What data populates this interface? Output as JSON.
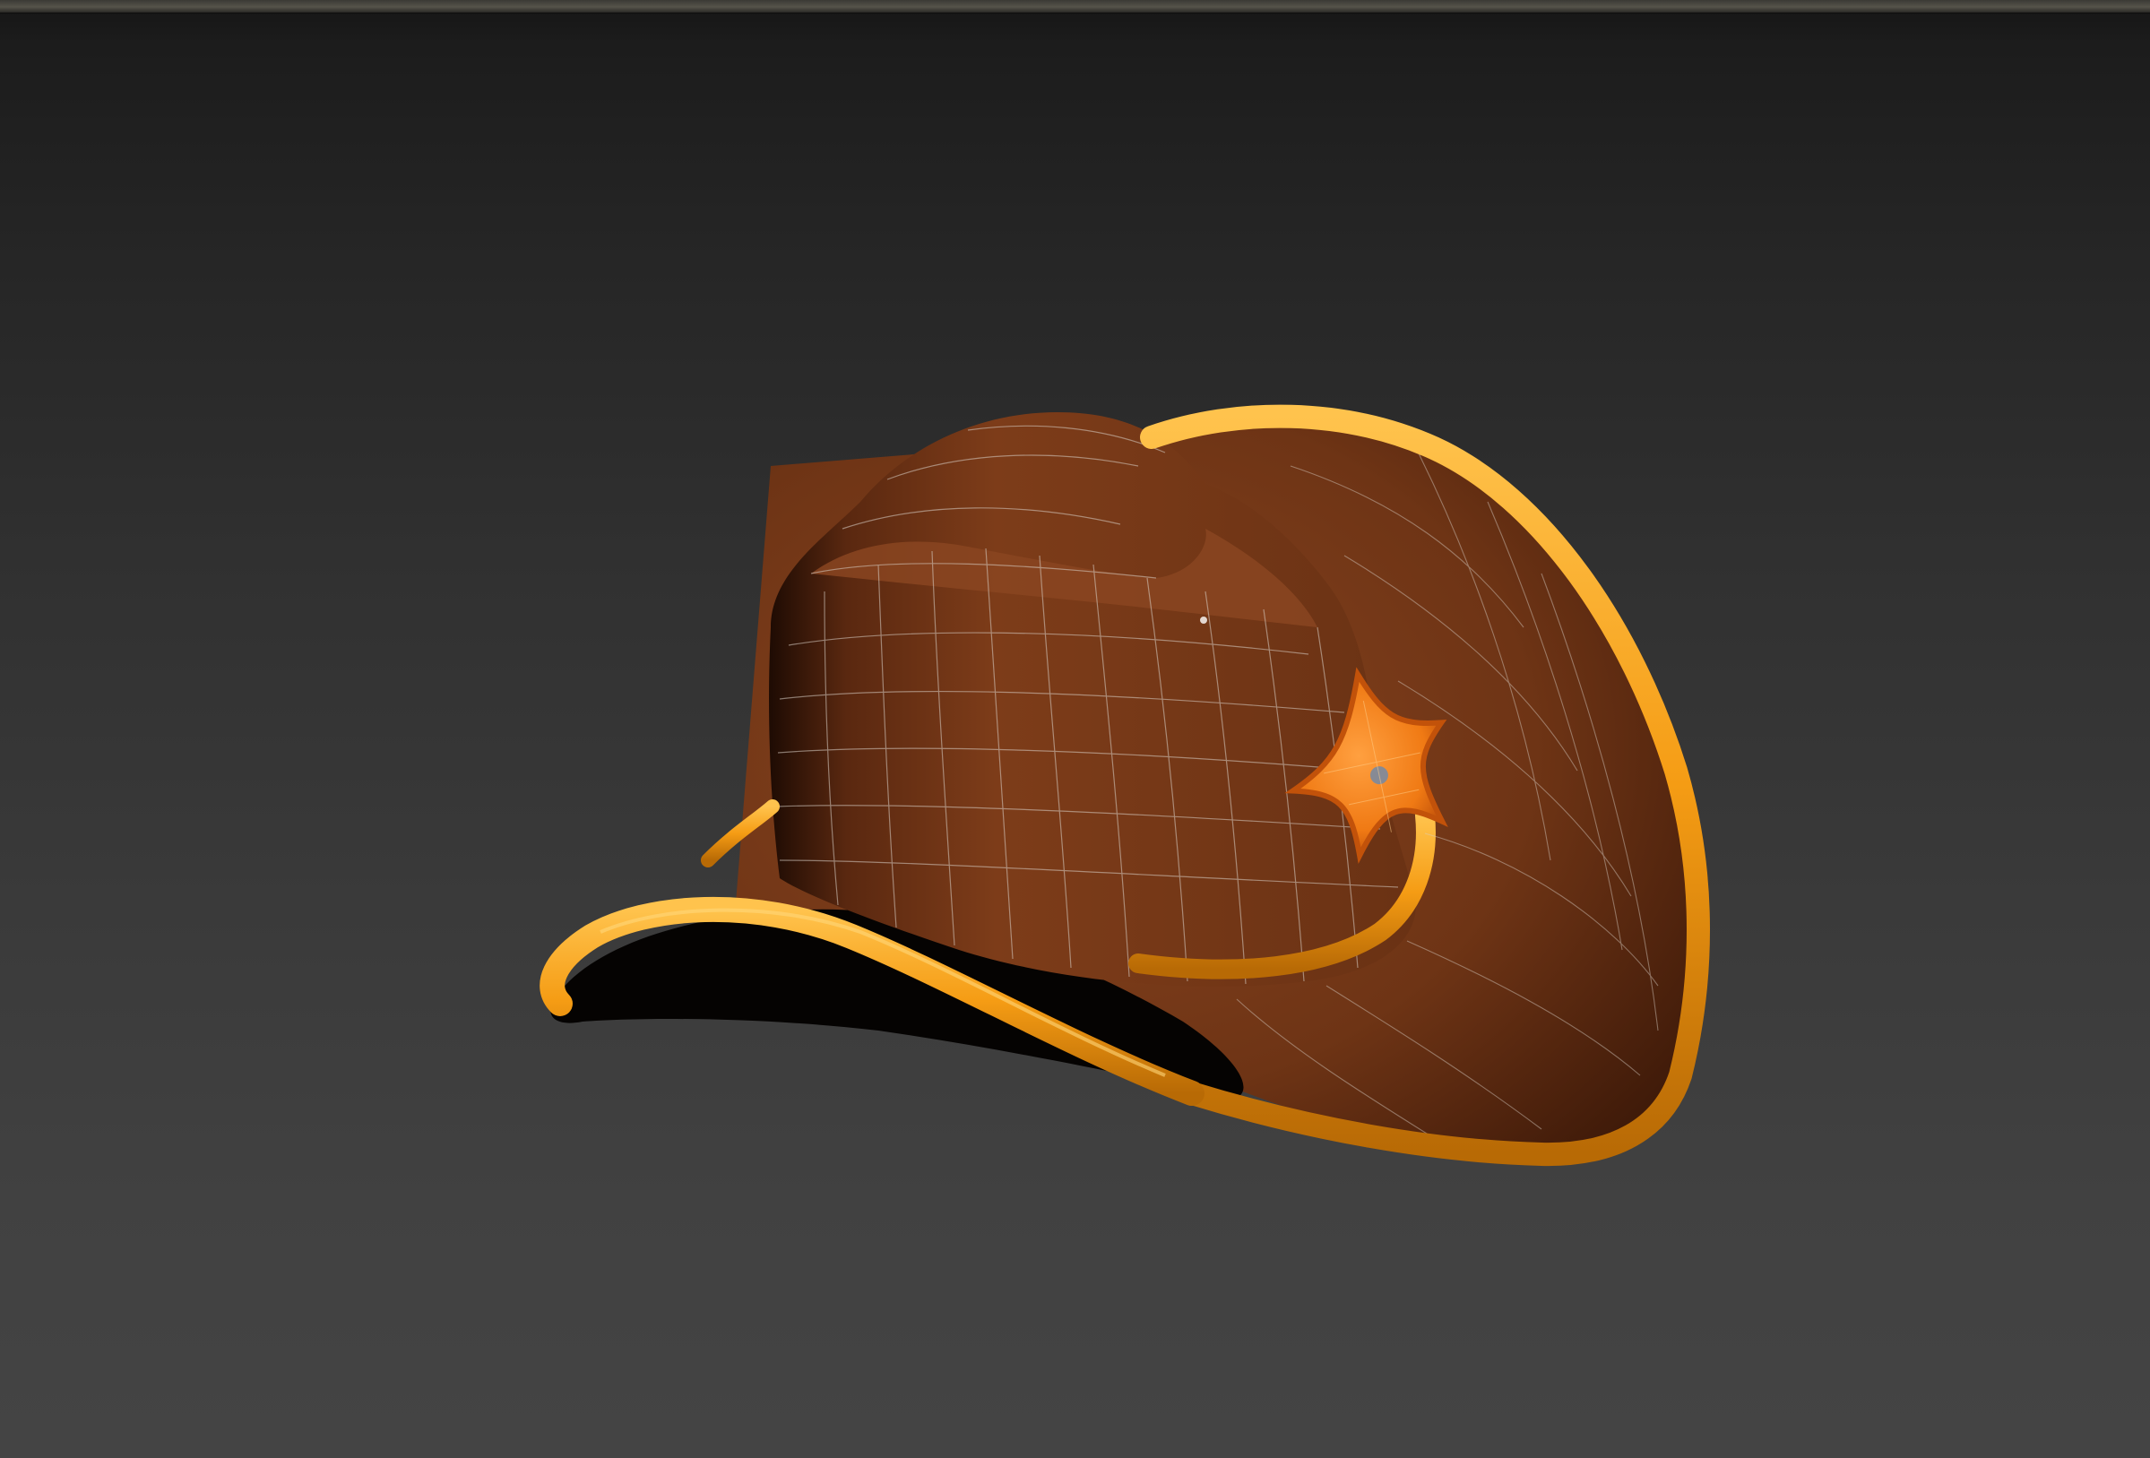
{
  "viewport": {
    "background_top": "#151515",
    "background_bottom": "#444444",
    "border_color": "#55534a"
  },
  "model": {
    "object": "cowboy-hat",
    "display_mode": "edged-faces",
    "colors": {
      "felt": "#7a3a18",
      "felt_shadow": "#3a1708",
      "brim_inner": "#6b3414",
      "trim": "#f39a12",
      "trim_highlight": "#ffc24a",
      "badge": "#f07c16",
      "badge_edge": "#c2520a",
      "wireframe": "#d8cfc6"
    }
  }
}
